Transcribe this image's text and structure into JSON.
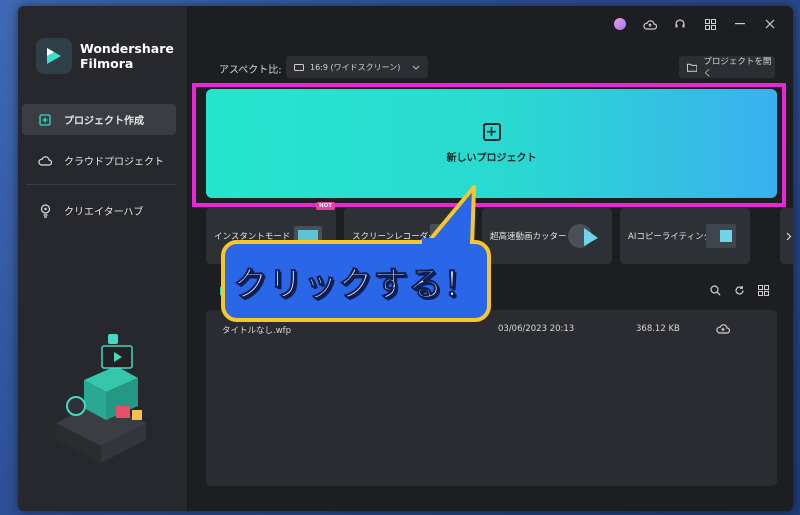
{
  "app": {
    "name_line1": "Wondershare",
    "name_line2": "Filmora"
  },
  "sidebar": {
    "items": [
      {
        "label": "プロジェクト作成",
        "icon": "new-project-icon",
        "active": true
      },
      {
        "label": "クラウドプロジェクト",
        "icon": "cloud-icon",
        "active": false
      },
      {
        "label": "クリエイターハブ",
        "icon": "lightbulb-icon",
        "active": false
      }
    ]
  },
  "topbar": {
    "icons": [
      "avatar-icon",
      "cloud-sync-icon",
      "headset-icon",
      "grid-apps-icon",
      "minimize-icon",
      "close-icon"
    ]
  },
  "aspect": {
    "label": "アスペクト比:",
    "value": "16:9 (ワイドスクリーン)"
  },
  "open_project_label": "プロジェクトを開く",
  "new_project_label": "新しいプロジェクト",
  "tools": [
    {
      "label": "インスタントモード",
      "badge": "HOT"
    },
    {
      "label": "スクリーンレコーダー"
    },
    {
      "label": "超高速動画カッター"
    },
    {
      "label": "AIコピーライティング"
    }
  ],
  "recent": {
    "files": [
      {
        "name": "タイトルなし.wfp",
        "date": "03/06/2023 20:13",
        "size": "368.12 KB"
      }
    ]
  },
  "callout": {
    "text": "クリックする！"
  },
  "colors": {
    "accent": "#2fe0c5",
    "highlight": "#e826d7",
    "callout_fill": "#2a66e8",
    "callout_border": "#f7c62a"
  }
}
